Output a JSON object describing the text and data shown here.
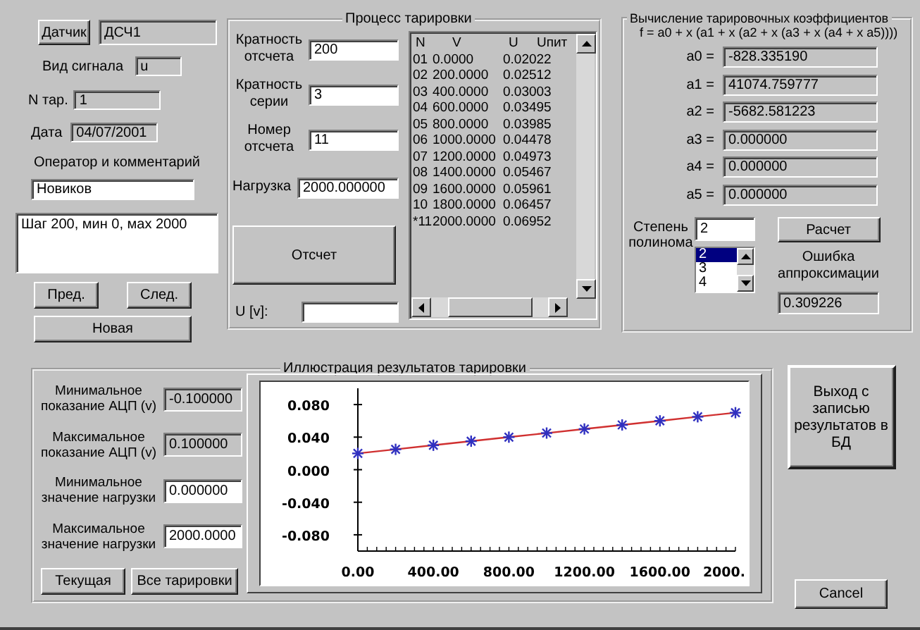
{
  "sensor": {
    "button": "Датчик",
    "value": "ДСЧ1",
    "readonly": true
  },
  "signal": {
    "label": "Вид сигнала",
    "value": "u",
    "readonly": true
  },
  "number": {
    "label": "N тар.",
    "value": "1",
    "readonly": true
  },
  "date": {
    "label": "Дата",
    "value": "04/07/2001",
    "readonly": true
  },
  "operator": {
    "label": "Оператор и комментарий",
    "value": "Новиков",
    "comment": "Шаг 200, мин 0, мах 2000"
  },
  "nav_buttons": [
    "Пред.",
    "След.",
    "Новая"
  ],
  "process": {
    "title": "Процесс тарировки",
    "fields": [
      {
        "label": "Кратность отсчета",
        "value": "200",
        "readonly": false
      },
      {
        "label": "Кратность серии",
        "value": "3",
        "readonly": false
      },
      {
        "label": "Номер отсчета",
        "value": "11",
        "readonly": false
      },
      {
        "label": "Нагрузка",
        "value": "2000.000000",
        "readonly": false
      }
    ],
    "button": "Отсчет",
    "u_field": {
      "label": "U [v]:",
      "readonly": false
    },
    "list": {
      "columns": [
        "N",
        "V",
        "U",
        "Uпит"
      ],
      "rows": [
        {
          "n": "01",
          "v": "0.0000",
          "u": "0.02022"
        },
        {
          "n": "02",
          "v": "200.0000",
          "u": "0.02512"
        },
        {
          "n": "03",
          "v": "400.0000",
          "u": "0.03003"
        },
        {
          "n": "04",
          "v": "600.0000",
          "u": "0.03495"
        },
        {
          "n": "05",
          "v": "800.0000",
          "u": "0.03985"
        },
        {
          "n": "06",
          "v": "1000.0000",
          "u": "0.04478"
        },
        {
          "n": "07",
          "v": "1200.0000",
          "u": "0.04973"
        },
        {
          "n": "08",
          "v": "1400.0000",
          "u": "0.05467"
        },
        {
          "n": "09",
          "v": "1600.0000",
          "u": "0.05961"
        },
        {
          "n": "10",
          "v": "1800.0000",
          "u": "0.06457"
        },
        {
          "n": "*11",
          "v": "2000.0000",
          "u": "0.06952"
        }
      ]
    }
  },
  "coefficients": {
    "title": "Вычисление тарировочных коэффициентов",
    "formula": "f = a0 + x (a1 + x (a2 + x (a3 + x (a4 + x a5))))",
    "values": [
      {
        "label": "a0 =",
        "value": "-828.335190",
        "readonly": true
      },
      {
        "label": "a1 =",
        "value": "41074.759777",
        "readonly": true
      },
      {
        "label": "a2 =",
        "value": "-5682.581223",
        "readonly": true
      },
      {
        "label": "a3 =",
        "value": "0.000000",
        "readonly": true
      },
      {
        "label": "a4 =",
        "value": "0.000000",
        "readonly": true
      },
      {
        "label": "a5 =",
        "value": "0.000000",
        "readonly": true
      }
    ],
    "degree": {
      "label": "Степень полинома",
      "value": "2",
      "options": [
        {
          "label": "2",
          "selected": true
        },
        {
          "label": "3",
          "selected": false
        },
        {
          "label": "4",
          "selected": false
        }
      ]
    },
    "button": "Расчет",
    "error_label": "Ошибка аппроксимации",
    "error": {
      "value": "0.309226",
      "readonly": true
    }
  },
  "illustration": {
    "title": "Иллюстрация результатов тарировки",
    "fields": [
      {
        "label": "Минимальное показание АЦП (v)",
        "value": "-0.100000",
        "readonly": true
      },
      {
        "label": "Максимальное показание АЦП (v)",
        "value": "0.100000",
        "readonly": true
      },
      {
        "label": "Минимальное значение нагрузки",
        "value": "0.000000",
        "readonly": false
      },
      {
        "label": "Максимальное значение нагрузки",
        "value": "2000.0000",
        "readonly": false
      }
    ],
    "buttons": [
      "Текущая",
      "Все тарировки"
    ],
    "chart_data": {
      "type": "line",
      "x": [
        0,
        200,
        400,
        600,
        800,
        1000,
        1200,
        1400,
        1600,
        1800,
        2000
      ],
      "series": [
        {
          "color": "#d03030",
          "marker": "cross",
          "values": [
            0.02,
            0.025,
            0.03,
            0.035,
            0.04,
            0.045,
            0.05,
            0.055,
            0.06,
            0.065,
            0.07
          ]
        }
      ],
      "xlim": [
        0,
        2000
      ],
      "ylim": [
        -0.1,
        0.1
      ],
      "xticks": [
        {
          "value": 0,
          "label": "0.00"
        },
        {
          "value": 400,
          "label": "400.00"
        },
        {
          "value": 800,
          "label": "800.00"
        },
        {
          "value": 1200,
          "label": "1200.00"
        },
        {
          "value": 1600,
          "label": "1600.00"
        },
        {
          "value": 2000,
          "label": "2000."
        }
      ],
      "yticks": [
        {
          "value": 0.08,
          "label": "0.080"
        },
        {
          "value": 0.04,
          "label": "0.040"
        },
        {
          "value": 0,
          "label": "0.000"
        },
        {
          "value": -0.04,
          "label": "-0.040"
        },
        {
          "value": -0.08,
          "label": "-0.080"
        }
      ]
    }
  },
  "save_button": "Выход с записью результатов в БД",
  "cancel_button": "Cancel"
}
